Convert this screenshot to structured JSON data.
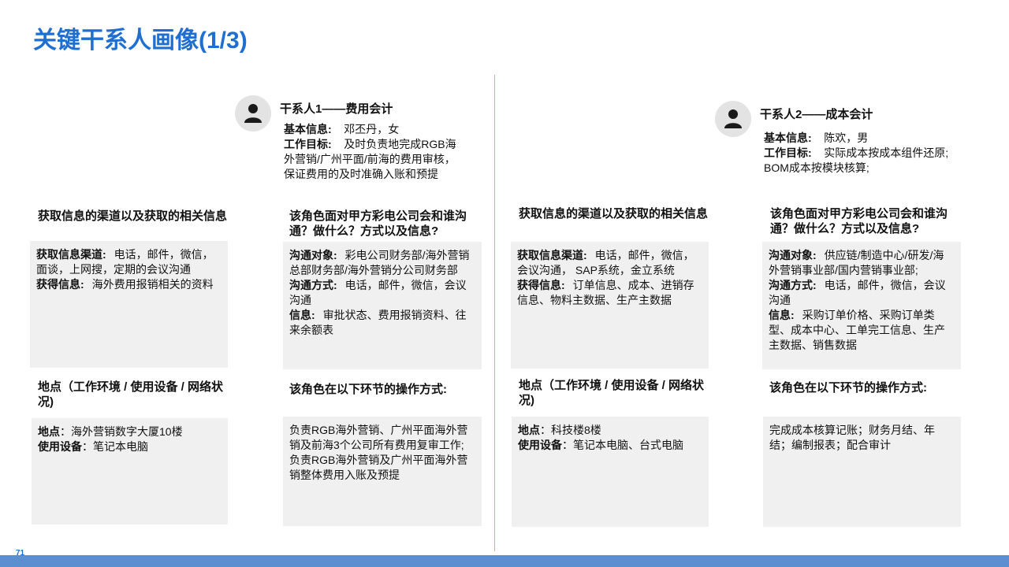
{
  "title": "关键干系人画像(1/3)",
  "page_number": "71",
  "persons": [
    {
      "name": "干系人1——费用会计",
      "basic_label": "基本信息:",
      "basic_value": "邓丕丹，女",
      "goal_label": "工作目标:",
      "goal_value": "及时负责地完成RGB海外营销/广州平面/前海的费用审核，保证费用的及时准确入账和预提",
      "channel_title": "获取信息的渠道以及获取的相关信息",
      "channel_label": "获取信息渠道:",
      "channel_value": "电话，邮件，微信，面谈，上网搜，定期的会议沟通",
      "info_label": "获得信息:",
      "info_value": "海外费用报销相关的资料",
      "comm_title": "该角色面对甲方彩电公司会和谁沟通？做什么？方式以及信息?",
      "target_label": "沟通对象:",
      "target_value": "彩电公司财务部/海外营销总部财务部/海外营销分公司财务部",
      "method_label": "沟通方式:",
      "method_value": "电话，邮件，微信，会议沟通",
      "msg_label": "信息:",
      "msg_value": "审批状态、费用报销资料、往来余额表",
      "location_title": "地点（工作环境 / 使用设备 / 网络状况)",
      "loc_label": "地点",
      "loc_value": "：海外营销数字大厦10楼",
      "device_label": "使用设备",
      "device_value": "：笔记本电脑",
      "ops_title": "该角色在以下环节的操作方式:",
      "ops_value": "负责RGB海外营销、广州平面海外营销及前海3个公司所有费用复审工作;\n负责RGB海外营销及广州平面海外营销整体费用入账及预提"
    },
    {
      "name": "干系人2——成本会计",
      "basic_label": "基本信息:",
      "basic_value": "陈欢，男",
      "goal_label": "工作目标:",
      "goal_value": "实际成本按成本组件还原;  BOM成本按模块核算;",
      "channel_title": "获取信息的渠道以及获取的相关信息",
      "channel_label": "获取信息渠道:",
      "channel_value": "电话，邮件，微信，会议沟通，  SAP系统，金立系统",
      "info_label": "获得信息:",
      "info_value": "订单信息、成本、进销存信息、物料主数据、生产主数据",
      "comm_title": "该角色面对甲方彩电公司会和谁沟通？做什么？方式以及信息?",
      "target_label": "沟通对象:",
      "target_value": "供应链/制造中心/研发/海外营销事业部/国内营销事业部;",
      "method_label": "沟通方式:",
      "method_value": "电话，邮件，微信，会议沟通",
      "msg_label": "信息:",
      "msg_value": "采购订单价格、采购订单类型、成本中心、工单完工信息、生产主数据、销售数据",
      "location_title": "地点（工作环境 / 使用设备 / 网络状况)",
      "loc_label": "地点",
      "loc_value": "：科技楼8楼",
      "device_label": "使用设备",
      "device_value": "：笔记本电脑、台式电脑",
      "ops_title": "该角色在以下环节的操作方式:",
      "ops_value": "完成成本核算记账；财务月结、年结；编制报表；配合审计"
    }
  ],
  "colors": {
    "accent": "#1f6fd1",
    "divider": "#d4b36a",
    "box": "#f0f0f0",
    "bar": "#5b8fd0"
  }
}
